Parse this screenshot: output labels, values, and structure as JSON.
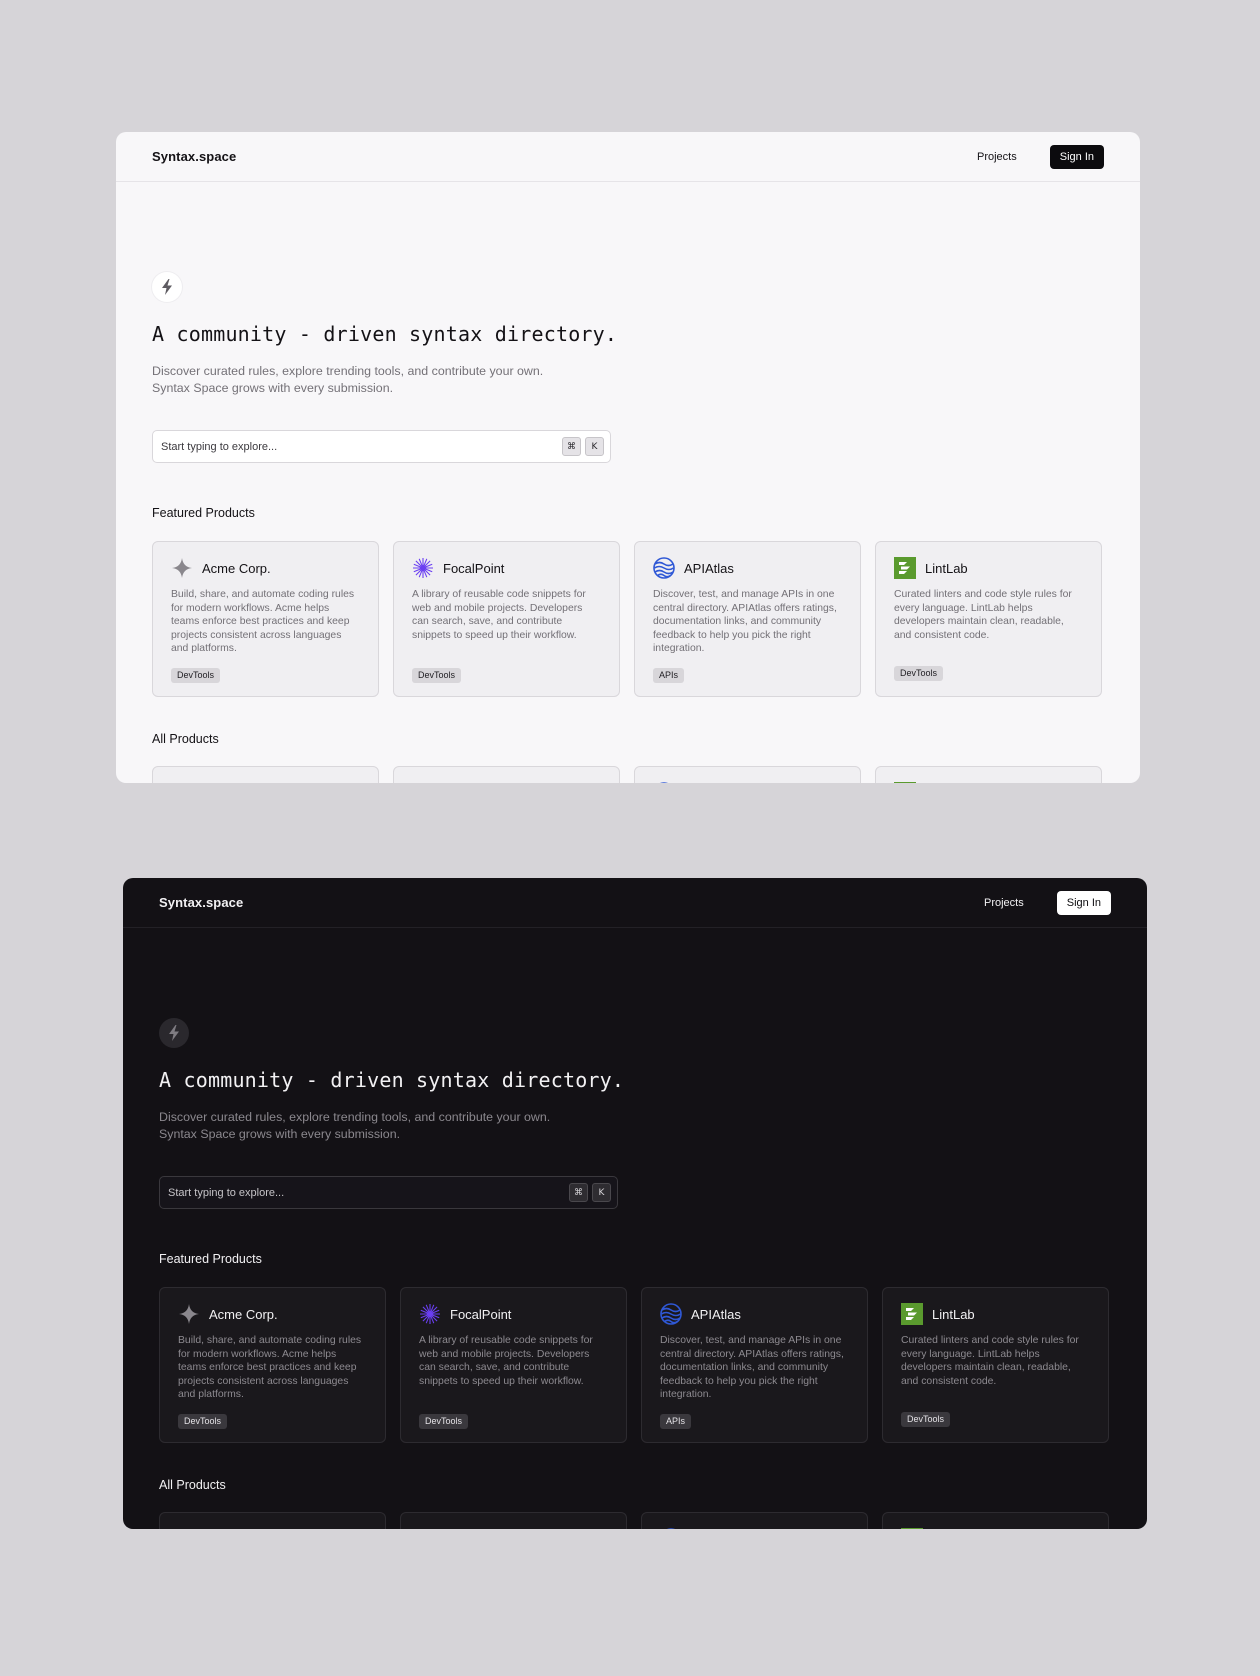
{
  "brand": "Syntax.space",
  "nav": {
    "projects": "Projects",
    "signin": "Sign In"
  },
  "hero": {
    "title": "A community - driven syntax directory.",
    "subtitle": "Discover curated rules, explore trending tools, and contribute your own. Syntax Space grows with every submission."
  },
  "search": {
    "placeholder": "Start typing to explore...",
    "kbd_cmd": "⌘",
    "kbd_key": "K"
  },
  "sections": {
    "featured": "Featured Products",
    "all": "All Products"
  },
  "products": [
    {
      "name": "Acme Corp.",
      "icon": "sparkle-icon",
      "description": "Build, share, and automate coding rules for modern workflows. Acme helps teams enforce best practices and keep projects consistent across languages and platforms.",
      "tag": "DevTools"
    },
    {
      "name": "FocalPoint",
      "icon": "starburst-icon",
      "description": "A library of reusable code snippets for web and mobile projects. Developers can search, save, and contribute snippets to speed up their workflow.",
      "tag": "DevTools"
    },
    {
      "name": "APIAtlas",
      "icon": "globe-waves-icon",
      "description": "Discover, test, and manage APIs in one central directory. APIAtlas offers ratings, documentation links, and community feedback to help you pick the right integration.",
      "tag": "APIs"
    },
    {
      "name": "LintLab",
      "icon": "lintlab-logo-icon",
      "description": "Curated linters and code style rules for every language. LintLab helps developers maintain clean, readable, and consistent code.",
      "tag": "DevTools"
    }
  ],
  "colors": {
    "focal_purple": "#6b3ff2",
    "atlas_blue": "#2f58d6",
    "lint_green": "#5a9a2e",
    "sparkle_gray": "#8a878d"
  }
}
